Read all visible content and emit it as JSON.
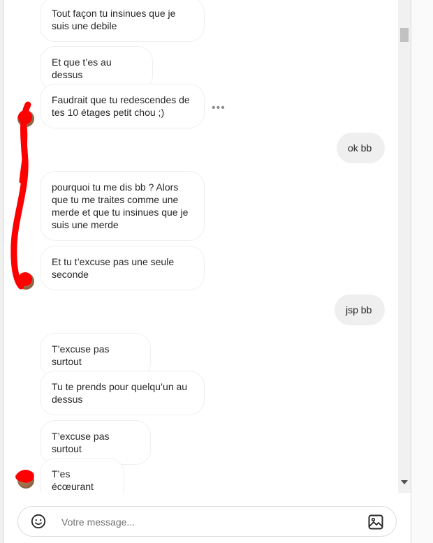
{
  "thread": {
    "messages": [
      {
        "id": "m1",
        "from": "them",
        "text": "Tout façon tu insinues que je suis une debile"
      },
      {
        "id": "m2",
        "from": "them",
        "text": "Et que t’es au dessus"
      },
      {
        "id": "m3",
        "from": "them",
        "text": "Faudrait que tu redescendes de tes 10 étages petit chou ;)"
      },
      {
        "id": "m4",
        "from": "me",
        "text": "ok bb"
      },
      {
        "id": "m5",
        "from": "them",
        "text": "pourquoi tu me dis bb ? Alors que tu me traites comme une merde et que tu insinues que je suis une merde"
      },
      {
        "id": "m6",
        "from": "them",
        "text": "Et tu t’excuse pas une seule seconde"
      },
      {
        "id": "m7",
        "from": "me",
        "text": "jsp bb"
      },
      {
        "id": "m8",
        "from": "them",
        "text": "T’excuse pas surtout"
      },
      {
        "id": "m9",
        "from": "them",
        "text": "Tu te prends pour quelqu’un au dessus"
      },
      {
        "id": "m10",
        "from": "them",
        "text": "T’excuse pas surtout"
      },
      {
        "id": "m11",
        "from": "them",
        "text": "T’es écœurant"
      }
    ],
    "more_options_icon": "more-horizontal-icon"
  },
  "composer": {
    "placeholder": "Votre message...",
    "emoji_icon": "emoji-icon",
    "image_icon": "image-icon"
  },
  "colors": {
    "incoming_bubble": "#ffffff",
    "outgoing_bubble": "#efefef",
    "text": "#262626",
    "redaction": "#ff0000"
  }
}
